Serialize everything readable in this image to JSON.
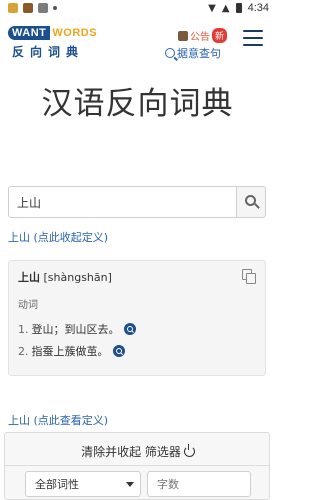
{
  "status_bar": {
    "time": "4:34",
    "icons": [
      "notification-icon",
      "notification-icon",
      "notification-icon",
      "dot-icon",
      "location-icon",
      "wifi-icon",
      "battery-icon"
    ]
  },
  "header": {
    "logo_want": "WANT",
    "logo_words": "WORDS",
    "logo_cn": "反向词典",
    "notice_label": "公告",
    "new_badge": "新",
    "reverse_search_link": "据意查句",
    "menu_icon": "hamburger-icon"
  },
  "title": "汉语反向词典",
  "search": {
    "value": "上山",
    "button_icon": "search-icon"
  },
  "collapse_link": "上山 (点此收起定义)",
  "definition": {
    "word": "上山",
    "pinyin": "[shàngshān]",
    "part_of_speech": "动词",
    "senses": [
      {
        "num": "1.",
        "text": "登山；到山区去。"
      },
      {
        "num": "2.",
        "text": "指蚕上蔟做茧。"
      }
    ]
  },
  "view_link": "上山 (点此查看定义)",
  "filter": {
    "title": "清除并收起 筛选器",
    "pos_select": "全部词性",
    "count_placeholder": "字数"
  },
  "colors": {
    "brand_blue": "#1b4f8e",
    "brand_orange": "#f0a51b",
    "link_blue": "#2b64b5",
    "badge_red": "#e53935"
  }
}
